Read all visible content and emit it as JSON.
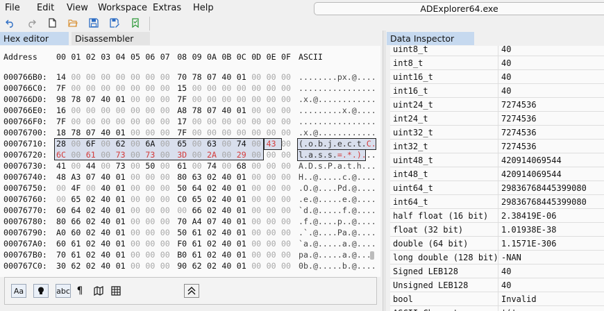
{
  "menu": [
    "File",
    "Edit",
    "View",
    "Workspace",
    "Extras",
    "Help"
  ],
  "window_title": "ADExplorer64.exe",
  "toolbar_icons": [
    "undo-icon",
    "redo-icon",
    "new-file-icon",
    "open-folder-icon",
    "save-icon",
    "save-as-icon",
    "bookmark-icon"
  ],
  "tabs_left": [
    {
      "label": "Hex editor",
      "active": true
    },
    {
      "label": "Disassembler",
      "active": false
    }
  ],
  "tabs_right": [
    {
      "label": "Data Inspector",
      "active": true
    }
  ],
  "hex": {
    "address_header": "Address",
    "column_headers": [
      "00",
      "01",
      "02",
      "03",
      "04",
      "05",
      "06",
      "07",
      "08",
      "09",
      "0A",
      "0B",
      "0C",
      "0D",
      "0E",
      "0F"
    ],
    "ascii_header": "ASCII",
    "rows": [
      {
        "addr": "000766B0:",
        "bytes": [
          "14",
          "00",
          "00",
          "00",
          "00",
          "00",
          "00",
          "00",
          "70",
          "78",
          "07",
          "40",
          "01",
          "00",
          "00",
          "00"
        ],
        "ascii": "........px.@...."
      },
      {
        "addr": "000766C0:",
        "bytes": [
          "7F",
          "00",
          "00",
          "00",
          "00",
          "00",
          "00",
          "00",
          "15",
          "00",
          "00",
          "00",
          "00",
          "00",
          "00",
          "00"
        ],
        "ascii": "................"
      },
      {
        "addr": "000766D0:",
        "bytes": [
          "98",
          "78",
          "07",
          "40",
          "01",
          "00",
          "00",
          "00",
          "7F",
          "00",
          "00",
          "00",
          "00",
          "00",
          "00",
          "00"
        ],
        "ascii": ".x.@............"
      },
      {
        "addr": "000766E0:",
        "bytes": [
          "16",
          "00",
          "00",
          "00",
          "00",
          "00",
          "00",
          "00",
          "A8",
          "78",
          "07",
          "40",
          "01",
          "00",
          "00",
          "00"
        ],
        "ascii": ".........x.@...."
      },
      {
        "addr": "000766F0:",
        "bytes": [
          "7F",
          "00",
          "00",
          "00",
          "00",
          "00",
          "00",
          "00",
          "17",
          "00",
          "00",
          "00",
          "00",
          "00",
          "00",
          "00"
        ],
        "ascii": "................"
      },
      {
        "addr": "00076700:",
        "bytes": [
          "18",
          "78",
          "07",
          "40",
          "01",
          "00",
          "00",
          "00",
          "7F",
          "00",
          "00",
          "00",
          "00",
          "00",
          "00",
          "00"
        ],
        "ascii": ".x.@............"
      },
      {
        "addr": "00076710:",
        "bytes": [
          "28",
          "00",
          "6F",
          "00",
          "62",
          "00",
          "6A",
          "00",
          "65",
          "00",
          "63",
          "00",
          "74",
          "00",
          "43",
          "00"
        ],
        "ascii": "(.o.b.j.e.c.t.C."
      },
      {
        "addr": "00076720:",
        "bytes": [
          "6C",
          "00",
          "61",
          "00",
          "73",
          "00",
          "73",
          "00",
          "3D",
          "00",
          "2A",
          "00",
          "29",
          "00",
          "00",
          "00"
        ],
        "ascii": "l.a.s.s.=.*.)..."
      },
      {
        "addr": "00076730:",
        "bytes": [
          "41",
          "00",
          "44",
          "00",
          "73",
          "00",
          "50",
          "00",
          "61",
          "00",
          "74",
          "00",
          "68",
          "00",
          "00",
          "00"
        ],
        "ascii": "A.D.s.P.a.t.h..."
      },
      {
        "addr": "00076740:",
        "bytes": [
          "48",
          "A3",
          "07",
          "40",
          "01",
          "00",
          "00",
          "00",
          "80",
          "63",
          "02",
          "40",
          "01",
          "00",
          "00",
          "00"
        ],
        "ascii": "H..@.....c.@...."
      },
      {
        "addr": "00076750:",
        "bytes": [
          "00",
          "4F",
          "00",
          "40",
          "01",
          "00",
          "00",
          "00",
          "50",
          "64",
          "02",
          "40",
          "01",
          "00",
          "00",
          "00"
        ],
        "ascii": ".O.@....Pd.@...."
      },
      {
        "addr": "00076760:",
        "bytes": [
          "00",
          "65",
          "02",
          "40",
          "01",
          "00",
          "00",
          "00",
          "C0",
          "65",
          "02",
          "40",
          "01",
          "00",
          "00",
          "00"
        ],
        "ascii": ".e.@.....e.@...."
      },
      {
        "addr": "00076770:",
        "bytes": [
          "60",
          "64",
          "02",
          "40",
          "01",
          "00",
          "00",
          "00",
          "00",
          "66",
          "02",
          "40",
          "01",
          "00",
          "00",
          "00"
        ],
        "ascii": "`d.@.....f.@...."
      },
      {
        "addr": "00076780:",
        "bytes": [
          "80",
          "66",
          "02",
          "40",
          "01",
          "00",
          "00",
          "00",
          "70",
          "A4",
          "07",
          "40",
          "01",
          "00",
          "00",
          "00"
        ],
        "ascii": ".f.@....p..@...."
      },
      {
        "addr": "00076790:",
        "bytes": [
          "A0",
          "60",
          "02",
          "40",
          "01",
          "00",
          "00",
          "00",
          "50",
          "61",
          "02",
          "40",
          "01",
          "00",
          "00",
          "00"
        ],
        "ascii": ".`.@....Pa.@...."
      },
      {
        "addr": "000767A0:",
        "bytes": [
          "60",
          "61",
          "02",
          "40",
          "01",
          "00",
          "00",
          "00",
          "F0",
          "61",
          "02",
          "40",
          "01",
          "00",
          "00",
          "00"
        ],
        "ascii": "`a.@.....a.@...."
      },
      {
        "addr": "000767B0:",
        "bytes": [
          "70",
          "61",
          "02",
          "40",
          "01",
          "00",
          "00",
          "00",
          "B0",
          "61",
          "02",
          "40",
          "01",
          "00",
          "00",
          "00"
        ],
        "ascii": "pa.@.....a.@...."
      },
      {
        "addr": "000767C0:",
        "bytes": [
          "30",
          "62",
          "02",
          "40",
          "01",
          "00",
          "00",
          "00",
          "90",
          "62",
          "02",
          "40",
          "01",
          "00",
          "00",
          "00"
        ],
        "ascii": "0b.@.....b.@...."
      }
    ]
  },
  "bottom_toolbar": [
    {
      "name": "match-case-button",
      "text": "Aa",
      "icon": ""
    },
    {
      "name": "highlight-button",
      "text": "",
      "icon": "lightbulb-icon"
    },
    {
      "name": "abc-button",
      "text": "abc",
      "icon": ""
    },
    {
      "name": "pilcrow-button",
      "text": "¶",
      "icon": ""
    },
    {
      "name": "map-button",
      "text": "",
      "icon": "map-icon"
    },
    {
      "name": "table-button",
      "text": "",
      "icon": "table-icon"
    },
    {
      "name": "collapse-button",
      "text": "",
      "icon": "double-chevron-up-icon"
    }
  ],
  "inspector": [
    {
      "name": "uint8_t",
      "value": "40"
    },
    {
      "name": "int8_t",
      "value": "40"
    },
    {
      "name": "uint16_t",
      "value": "40"
    },
    {
      "name": "int16_t",
      "value": "40"
    },
    {
      "name": "uint24_t",
      "value": "7274536"
    },
    {
      "name": "int24_t",
      "value": "7274536"
    },
    {
      "name": "uint32_t",
      "value": "7274536"
    },
    {
      "name": "int32_t",
      "value": "7274536"
    },
    {
      "name": "uint48_t",
      "value": "420914069544"
    },
    {
      "name": "int48_t",
      "value": "420914069544"
    },
    {
      "name": "uint64_t",
      "value": "29836768445399080"
    },
    {
      "name": "int64_t",
      "value": "29836768445399080"
    },
    {
      "name": "half float (16 bit)",
      "value": "2.38419E-06"
    },
    {
      "name": "float (32 bit)",
      "value": "1.01938E-38"
    },
    {
      "name": "double (64 bit)",
      "value": "1.1571E-306"
    },
    {
      "name": "long double (128 bit)",
      "value": "-NAN"
    },
    {
      "name": "Signed LEB128",
      "value": "40"
    },
    {
      "name": "Unsigned LEB128",
      "value": "40"
    },
    {
      "name": "bool",
      "value": "Invalid"
    },
    {
      "name": "ASCII Character",
      "value": "'('"
    }
  ],
  "colors": {
    "accent_tab": "#c6d9ef",
    "highlight_text": "#d43c3c",
    "zero_byte": "#a7a7a7",
    "undo_icon": "#2b6cc4"
  }
}
